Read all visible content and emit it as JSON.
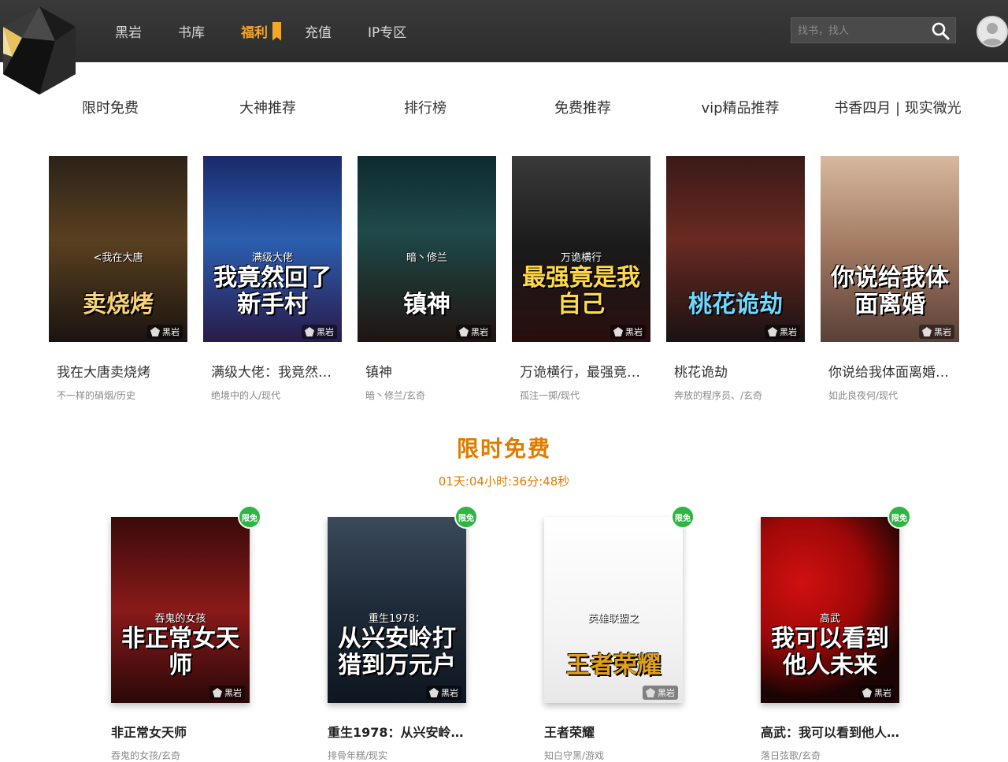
{
  "header": {
    "nav": [
      {
        "label": "黑岩"
      },
      {
        "label": "书库"
      },
      {
        "label": "福利",
        "active": true
      },
      {
        "label": "充值"
      },
      {
        "label": "IP专区"
      }
    ],
    "search_placeholder": "找书，找人",
    "accent": "#f5a623"
  },
  "categories": [
    "限时免费",
    "大神推荐",
    "排行榜",
    "免费推荐",
    "vip精品推荐",
    "书香四月 | 现实微光"
  ],
  "top_books": [
    {
      "title": "我在大唐卖烧烤",
      "meta": "不一样的硝烟/历史",
      "cover_sub": "<我在大唐",
      "cover_title": "卖烧烤",
      "bg": "linear-gradient(180deg,#2a2218 0%,#5a4020 45%,#1a1410 100%)",
      "title_color": "#f7d27a"
    },
    {
      "title": "满级大佬：我竟然…",
      "meta": "绝境中的人/现代",
      "cover_sub": "满级大佬",
      "cover_title": "我竟然回了新手村",
      "bg": "linear-gradient(180deg,#1a2a6a 0%,#2b5fb0 45%,#2a1a4a 100%)",
      "title_color": "#ffffff"
    },
    {
      "title": "镇神",
      "meta": "暗丶修兰/玄奇",
      "cover_sub": "暗丶修兰",
      "cover_title": "镇神",
      "bg": "linear-gradient(180deg,#0f2a30 0%,#1e4a4a 40%,#201410 100%)",
      "title_color": "#ffffff"
    },
    {
      "title": "万诡横行，最强竟…",
      "meta": "孤注一掷/现代",
      "cover_sub": "万诡横行",
      "cover_title": "最强竟是我自己",
      "bg": "linear-gradient(180deg,#3a3a3a 0%,#1a1a1a 50%,#2a0e0e 100%)",
      "title_color": "#ffd84a"
    },
    {
      "title": "桃花诡劫",
      "meta": "奔放的程序员、/玄奇",
      "cover_sub": "",
      "cover_title": "桃花诡劫",
      "bg": "linear-gradient(180deg,#3a1a18 0%,#6a2a22 45%,#1a1212 100%)",
      "title_color": "#6fd8ff"
    },
    {
      "title": "你说给我体面离婚…",
      "meta": "如此良夜何/现代",
      "cover_sub": "",
      "cover_title": "你说给我体面离婚",
      "bg": "linear-gradient(180deg,#d8b8a0 0%,#a07860 50%,#5a4038 100%)",
      "title_color": "#ffffff"
    }
  ],
  "free_section": {
    "title": "限时免费",
    "countdown": "01天:04小时:36分:48秒",
    "badge": "限免",
    "books": [
      {
        "title": "非正常女天师",
        "meta": "吞鬼的女孩/玄奇",
        "cover_sub": "吞鬼的女孩",
        "cover_title": "非正常女天师",
        "bg": "linear-gradient(180deg,#3a0a0a 0%,#8a1a1a 50%,#2a0808 100%)",
        "title_color": "#ffffff"
      },
      {
        "title": "重生1978：从兴安岭…",
        "meta": "排骨年糕/现实",
        "cover_sub": "重生1978：",
        "cover_title": "从兴安岭打猎到万元户",
        "bg": "linear-gradient(180deg,#3a4a5a 0%,#1e2a38 50%,#0e1620 100%)",
        "title_color": "#ffffff"
      },
      {
        "title": "王者荣耀",
        "meta": "知白守黑/游戏",
        "cover_sub": "英雄联盟之",
        "cover_title": "王者荣耀",
        "bg": "linear-gradient(180deg,#ffffff 0%,#f4f4f4 60%,#e8e8e8 100%)",
        "title_color": "#e0a020"
      },
      {
        "title": "高武：我可以看到他人…",
        "meta": "落日弦歌/玄奇",
        "cover_sub": "高武",
        "cover_title": "我可以看到他人未来",
        "bg": "radial-gradient(circle at 30% 35%,#d01010 0%,#a00808 40%,#1a0404 75%)",
        "title_color": "#ffffff"
      }
    ]
  },
  "brand_label": "黑岩"
}
